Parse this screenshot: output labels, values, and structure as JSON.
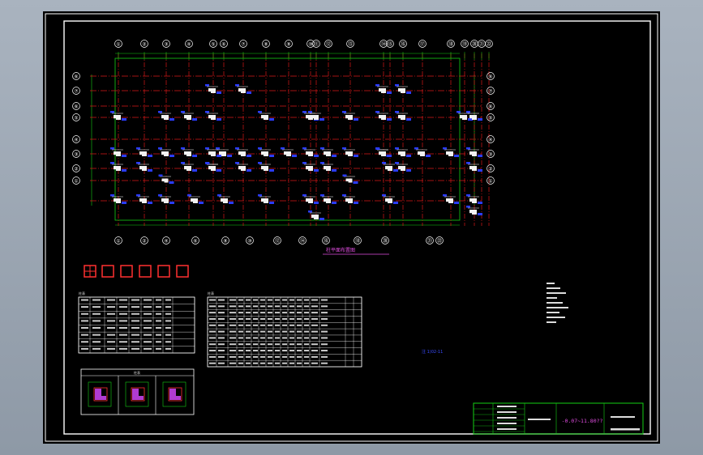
{
  "drawing": {
    "grid_top_labels": [
      "①",
      "②",
      "③",
      "④",
      "⑤",
      "⑥",
      "⑦",
      "⑧",
      "⑨",
      "⑩",
      "⑪",
      "⑫",
      "⑬",
      "⑭",
      "⑮",
      "⑯",
      "⑰",
      "⑱",
      "⑲",
      "⑳",
      "㉑",
      "㉒"
    ],
    "grid_bottom_labels": [
      "①",
      "②",
      "④",
      "⑥",
      "⑧",
      "⑩",
      "⑫",
      "⑭",
      "⑯",
      "⑱",
      "⑳",
      "㉑",
      "㉒"
    ],
    "grid_side_labels": [
      "⑥",
      "⑦",
      "⑥",
      "⑤",
      "④",
      "③",
      "②",
      "①"
    ],
    "plan_title": "柱平面布置图",
    "note_text": "注 1)02-11",
    "elevation_text": "-0.07~11.80??",
    "legend_title": "柱表",
    "table1_title": "柱表",
    "table2_title": "柱表"
  },
  "colors": {
    "grid_line": "#d81818",
    "dim_line": "#13d013",
    "column_fill": "#f2f2f2",
    "column_tag": "#2a3cff",
    "frame": "#ffffff",
    "title_block": "#13d013",
    "elevation_text": "#e14ee1",
    "label_text": "#e8e8e8"
  },
  "icons": {
    "section_symbols": [
      "square-with-cross-icon",
      "square-icon",
      "square-icon",
      "square-icon",
      "square-icon",
      "square-icon"
    ]
  }
}
